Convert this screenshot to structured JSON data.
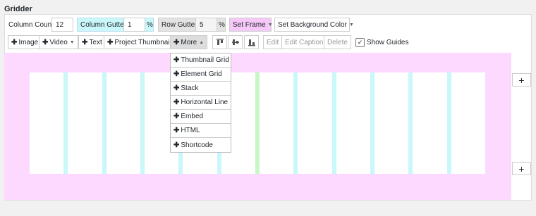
{
  "panel_title": "Gridder",
  "settings": {
    "column_count": {
      "label": "Column Count",
      "value": "12"
    },
    "column_gutter": {
      "label": "Column Gutter",
      "value": "1",
      "unit": "%"
    },
    "row_gutter": {
      "label": "Row Gutter",
      "value": "5",
      "unit": "%"
    },
    "set_frame": "Set Frame",
    "set_background": "Set Background Color"
  },
  "toolbar": {
    "add_buttons": [
      "Image",
      "Video",
      "Text",
      "Project Thumbnail",
      "More"
    ],
    "align_icons": [
      "align-top-icon",
      "align-middle-icon",
      "align-bottom-icon"
    ],
    "edit": "Edit",
    "edit_caption": "Edit Caption",
    "delete": "Delete",
    "show_guides": "Show Guides",
    "show_guides_checked": true
  },
  "more_menu": [
    "Thumbnail Grid",
    "Element Grid",
    "Stack",
    "Horizontal Line",
    "Embed",
    "HTML",
    "Shortcode"
  ],
  "side_controls": {
    "add_row_top": "+",
    "add_row_bottom": "+"
  },
  "colors": {
    "frame_bg": "#fdd9ff",
    "gutter": "#c9f7fa",
    "gutter_highlight": "#c8f7c5",
    "column_gutter_bg": "#c9f7fa",
    "row_gutter_bg": "#e3e3e3",
    "set_frame_bg": "#f5c8f8"
  }
}
